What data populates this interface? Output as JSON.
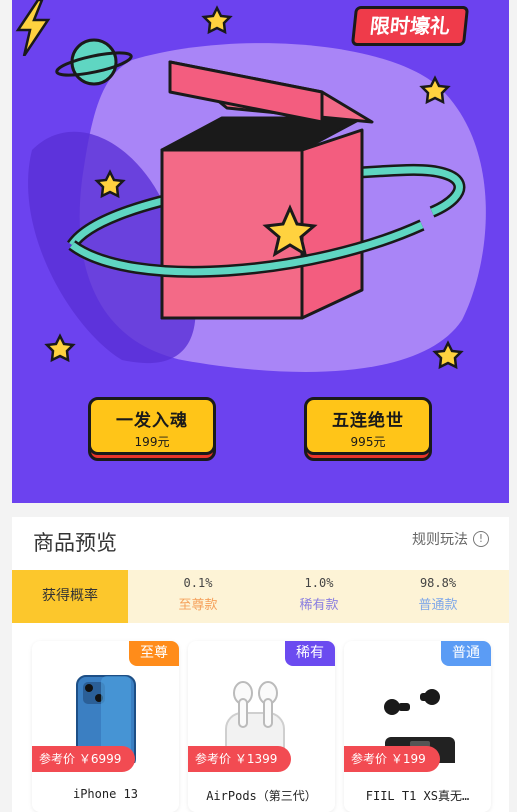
{
  "hero": {
    "badge_label": "限时壕礼",
    "single_draw": {
      "title": "一发入魂",
      "price": "199元"
    },
    "five_draw": {
      "title": "五连绝世",
      "price": "995元"
    }
  },
  "preview": {
    "title": "商品预览",
    "rules_label": "规则玩法",
    "probability_label": "获得概率",
    "tiers": [
      {
        "percent": "0.1%",
        "name": "至尊款",
        "color": "#f5a05a"
      },
      {
        "percent": "1.0%",
        "name": "稀有款",
        "color": "#8a7ee0"
      },
      {
        "percent": "98.8%",
        "name": "普通款",
        "color": "#7fa7e8"
      }
    ]
  },
  "products": [
    {
      "tag": "至尊",
      "tag_color": "#ff8c1a",
      "price": "参考价 ￥6999",
      "name": "iPhone 13"
    },
    {
      "tag": "稀有",
      "tag_color": "#6b4bf0",
      "price": "参考价 ￥1399",
      "name": "AirPods（第三代）"
    },
    {
      "tag": "普通",
      "tag_color": "#5b9cf5",
      "price": "参考价 ￥199",
      "name": "FIIL T1 XS真无…"
    }
  ],
  "colors": {
    "hero_bg": "#6c42ef",
    "button_yellow": "#ffc518",
    "price_red": "#f24b52"
  }
}
